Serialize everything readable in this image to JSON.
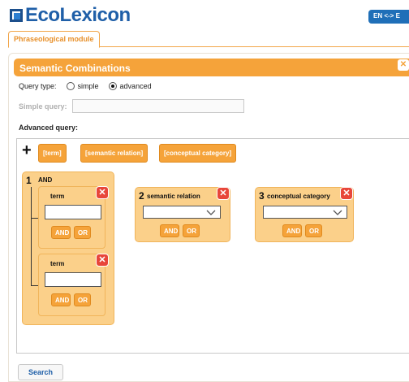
{
  "app": {
    "logo_text": "EcoLexicon"
  },
  "header": {
    "lang_toggle": "EN <-> E"
  },
  "tabs": [
    {
      "label": "Phraseological module"
    }
  ],
  "panel": {
    "title": "Semantic Combinations",
    "close_glyph": "✕"
  },
  "query_type": {
    "label": "Query type:",
    "options": [
      {
        "label": "simple",
        "checked": false
      },
      {
        "label": "advanced",
        "checked": true
      }
    ]
  },
  "simple_query": {
    "label": "Simple query:",
    "value": ""
  },
  "advanced_query": {
    "label": "Advanced query:",
    "add_glyph": "+",
    "chips": [
      "[term]",
      "[semantic relation]",
      "[conceptual category]"
    ],
    "blocks": [
      {
        "number": "1",
        "operator": "AND",
        "items": [
          {
            "label": "term",
            "value": "",
            "and": "AND",
            "or": "OR"
          },
          {
            "label": "term",
            "value": "",
            "and": "AND",
            "or": "OR"
          }
        ]
      },
      {
        "number": "2",
        "label": "semantic relation",
        "value": "",
        "and": "AND",
        "or": "OR"
      },
      {
        "number": "3",
        "label": "conceptual category",
        "value": "",
        "and": "AND",
        "or": "OR"
      }
    ]
  },
  "search_button": "Search",
  "colors": {
    "accent": "#f5a33a",
    "block_fill": "#fbd08a",
    "close_red": "#e8463a",
    "brand_blue": "#1f5fa8"
  },
  "icons": {
    "remove": "close-icon",
    "dropdown": "chevron-down-icon"
  }
}
